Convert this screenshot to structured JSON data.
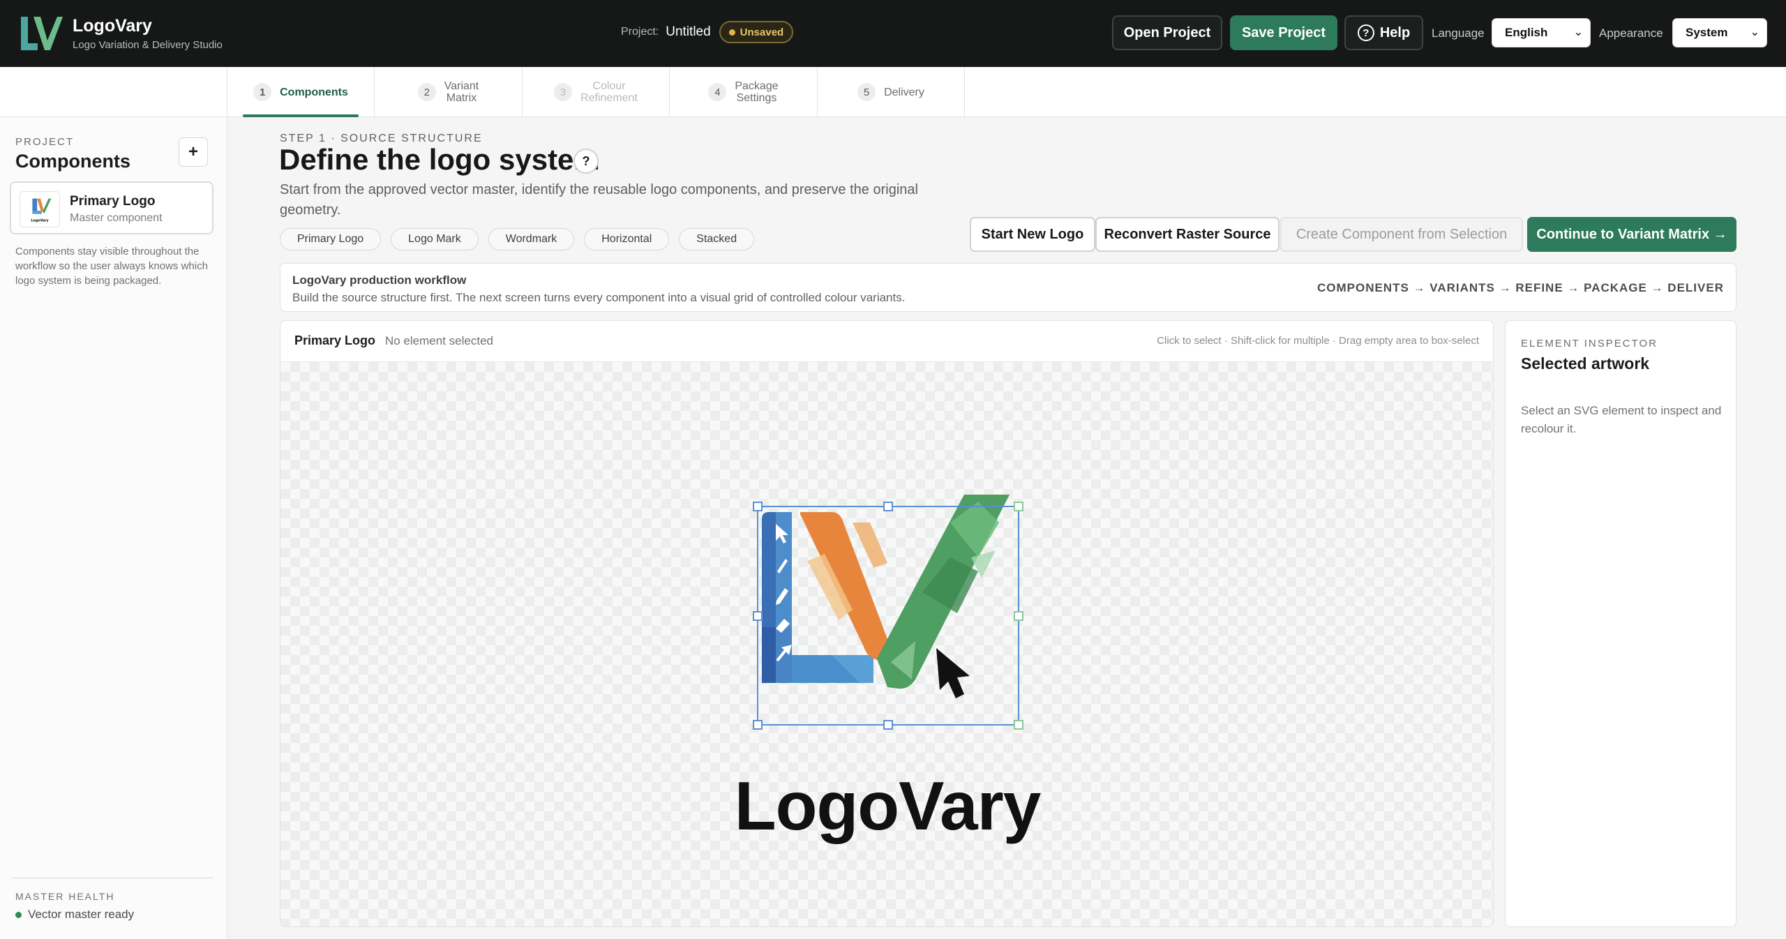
{
  "app": {
    "name": "LogoVary",
    "tagline": "Logo Variation & Delivery Studio"
  },
  "topbar": {
    "project_label": "Project:",
    "project_name": "Untitled",
    "status_badge": "Unsaved",
    "open_label": "Open Project",
    "save_label": "Save Project",
    "help_label": "Help",
    "language_label": "Language",
    "language_value": "English",
    "appearance_label": "Appearance",
    "appearance_value": "System"
  },
  "steps": [
    {
      "num": "1",
      "label": "Components",
      "state": "active"
    },
    {
      "num": "2",
      "label": "Variant\nMatrix",
      "state": "normal"
    },
    {
      "num": "3",
      "label": "Colour\nRefinement",
      "state": "disabled"
    },
    {
      "num": "4",
      "label": "Package\nSettings",
      "state": "normal"
    },
    {
      "num": "5",
      "label": "Delivery",
      "state": "normal"
    }
  ],
  "sidebar": {
    "eyebrow": "PROJECT",
    "title": "Components",
    "add_icon": "plus-icon",
    "components": [
      {
        "name": "Primary Logo",
        "sub": "Master component"
      }
    ],
    "note": "Components stay visible throughout the workflow so the user always knows which logo system is being packaged.",
    "health_eyebrow": "MASTER HEALTH",
    "health_value": "Vector master ready"
  },
  "main": {
    "eyebrow": "STEP 1 · SOURCE STRUCTURE",
    "title": "Define the logo system",
    "description": "Start from the approved vector master, identify the reusable logo components, and preserve the original geometry.",
    "chips": [
      "Primary Logo",
      "Logo Mark",
      "Wordmark",
      "Horizontal",
      "Stacked"
    ],
    "actions": {
      "start_new": "Start New Logo",
      "reconvert": "Reconvert Raster Source",
      "create_component": "Create Component from Selection",
      "continue": "Continue to Variant Matrix →"
    },
    "workflow": {
      "title": "LogoVary production workflow",
      "description": "Build the source structure first. The next screen turns every component into a visual grid of controlled colour variants.",
      "steps": "COMPONENTS → VARIANTS → REFINE → PACKAGE → DELIVER"
    },
    "canvas": {
      "component_name": "Primary Logo",
      "selection_status": "No element selected",
      "hint": "Click to select · Shift-click for multiple · Drag empty area to box-select",
      "wordmark": "LogoVary"
    }
  },
  "inspector": {
    "eyebrow": "ELEMENT INSPECTOR",
    "title": "Selected artwork",
    "body": "Select an SVG element to inspect and recolour it."
  },
  "colors": {
    "brand_green": "#2d7a5c",
    "topbar_bg": "#151817",
    "logo_blue": "#3f7fc4",
    "logo_orange": "#e8853d",
    "logo_green": "#4f9e62"
  }
}
